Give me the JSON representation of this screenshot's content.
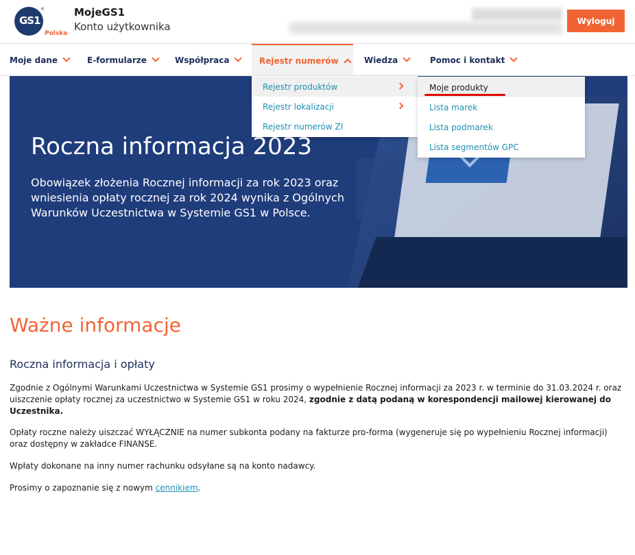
{
  "header": {
    "logo_text": "GS1",
    "logo_country": "Polska",
    "app_title": "MojeGS1",
    "app_subtitle": "Konto użytkownika",
    "logout_label": "Wyloguj"
  },
  "nav": {
    "items": [
      {
        "label": "Moje dane"
      },
      {
        "label": "E-formularze"
      },
      {
        "label": "Współpraca"
      },
      {
        "label": "Rejestr numerów"
      },
      {
        "label": "Wiedza"
      },
      {
        "label": "Pomoc i kontakt"
      }
    ]
  },
  "dropdown": {
    "items": [
      {
        "label": "Rejestr produktów"
      },
      {
        "label": "Rejestr lokalizacji"
      },
      {
        "label": "Rejestr numerów ZI"
      }
    ]
  },
  "submenu": {
    "items": [
      {
        "label": "Moje produkty"
      },
      {
        "label": "Lista marek"
      },
      {
        "label": "Lista podmarek"
      },
      {
        "label": "Lista segmentów GPC"
      }
    ]
  },
  "hero": {
    "title": "Roczna informacja 2023",
    "text": "Obowiązek złożenia Rocznej informacji za rok 2023 oraz wniesienia opłaty rocznej za rok 2024 wynika z Ogólnych Warunków Uczestnictwa w Systemie GS1 w Polsce."
  },
  "content": {
    "section_title": "Ważne informacje",
    "sub_title": "Roczna informacja i opłaty",
    "p1_normal": "Zgodnie z Ogólnymi Warunkami Uczestnictwa w Systemie GS1 prosimy o wypełnienie Rocznej informacji za 2023 r. w terminie do 31.03.2024 r. oraz uiszczenie opłaty rocznej za uczestnictwo w Systemie GS1 w roku 2024, ",
    "p1_bold": "zgodnie z datą podaną w korespondencji mailowej kierowanej do Uczestnika.",
    "p2": "Opłaty roczne należy uiszczać WYŁĄCZNIE na numer subkonta podany na fakturze pro-forma (wygeneruje się po wypełnieniu Rocznej informacji) oraz dostępny w zakładce FINANSE.",
    "p3": "Wpłaty dokonane na inny numer rachunku odsyłane są na konto nadawcy.",
    "p4_prefix": "Prosimy o zapoznanie się z nowym ",
    "p4_link": "cennikiem",
    "p4_suffix": "."
  },
  "colors": {
    "accent": "#f26334",
    "navy": "#1e2d5a",
    "hero_bg": "#1f3c7b",
    "link": "#1e8fb0"
  }
}
